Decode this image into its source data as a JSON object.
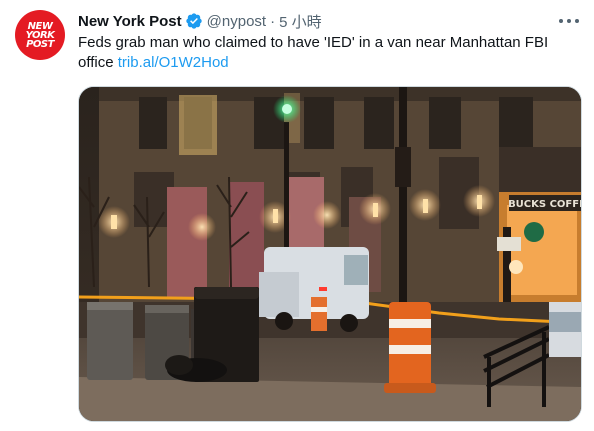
{
  "tweet": {
    "avatar_lines": [
      "NEW",
      "YORK",
      "POST"
    ],
    "display_name": "New York Post",
    "handle": "@nypost",
    "separator": "·",
    "time": "5 小時",
    "text": "Feds grab man who claimed to have 'IED' in a van near Manhattan FBI office",
    "link": "trib.al/O1W2Hod",
    "media_sign": "BUCKS COFFE"
  },
  "colors": {
    "brand": "#e41b23",
    "verified": "#1d9bf0",
    "link": "#1d9bf0"
  }
}
